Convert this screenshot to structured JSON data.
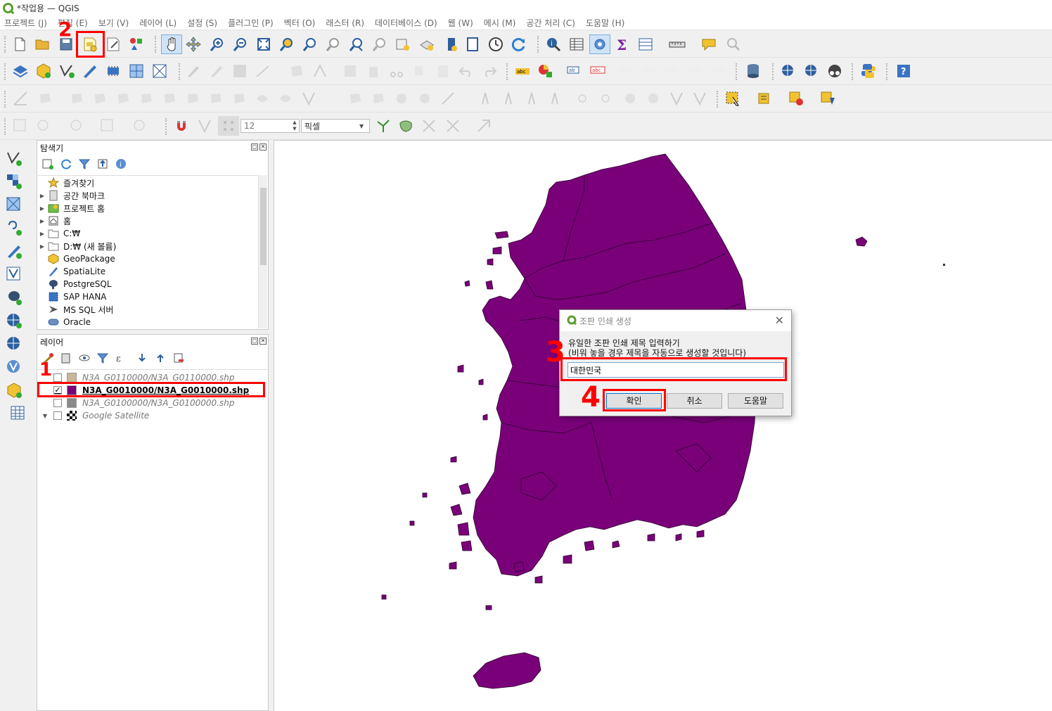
{
  "window": {
    "title": "*작업용 — QGIS"
  },
  "menu": [
    "프로젝트 (J)",
    "편집 (E)",
    "보기 (V)",
    "레이어 (L)",
    "설정 (S)",
    "플러그인 (P)",
    "벡터 (O)",
    "래스터 (R)",
    "데이터베이스 (D)",
    "웹 (W)",
    "메시 (M)",
    "공간 처리 (C)",
    "도움말 (H)"
  ],
  "snapping": {
    "tolerance": "12",
    "units": "픽셀"
  },
  "browser": {
    "title": "탐색기",
    "items": [
      {
        "label": "즐겨찾기",
        "icon": "star-icon",
        "expandable": false
      },
      {
        "label": "공간 북마크",
        "icon": "bookmark-icon",
        "expandable": true
      },
      {
        "label": "프로젝트 홈",
        "icon": "project-home-icon",
        "expandable": true
      },
      {
        "label": "홈",
        "icon": "home-icon",
        "expandable": true
      },
      {
        "label": "C:₩",
        "icon": "folder-icon",
        "expandable": true
      },
      {
        "label": "D:₩ (새 볼륨)",
        "icon": "folder-icon",
        "expandable": true
      },
      {
        "label": "GeoPackage",
        "icon": "geopackage-icon",
        "expandable": false
      },
      {
        "label": "SpatiaLite",
        "icon": "spatialite-icon",
        "expandable": false
      },
      {
        "label": "PostgreSQL",
        "icon": "postgresql-icon",
        "expandable": false
      },
      {
        "label": "SAP HANA",
        "icon": "sap-hana-icon",
        "expandable": false
      },
      {
        "label": "MS SQL 서버",
        "icon": "mssql-icon",
        "expandable": false
      },
      {
        "label": "Oracle",
        "icon": "oracle-icon",
        "expandable": false
      }
    ]
  },
  "layers": {
    "title": "레이어",
    "items": [
      {
        "label": "N3A_G0110000/N3A_G0110000.shp",
        "checked": false,
        "color": "#c8b79a",
        "active": false
      },
      {
        "label": "N3A_G0010000/N3A_G0010000.shp",
        "checked": true,
        "color": "#7a007a",
        "active": true
      },
      {
        "label": "N3A_G0100000/N3A_G0100000.shp",
        "checked": false,
        "color": "#8a8a8a",
        "active": false
      },
      {
        "label": "Google Satellite",
        "checked": false,
        "color": "",
        "active": false
      }
    ]
  },
  "dialog": {
    "title": "조판 인쇄 생성",
    "prompt_line1": "유일한 조판 인쇄 제목 입력하기",
    "prompt_line2": "(비워 놓을 경우 제목을 자동으로 생성할 것입니다)",
    "input_value": "대한민국",
    "ok": "확인",
    "cancel": "취소",
    "help": "도움말"
  },
  "annotations": [
    "1",
    "2",
    "3",
    "4"
  ],
  "colors": {
    "map_fill": "#7a007a",
    "accent": "#ff0000"
  }
}
